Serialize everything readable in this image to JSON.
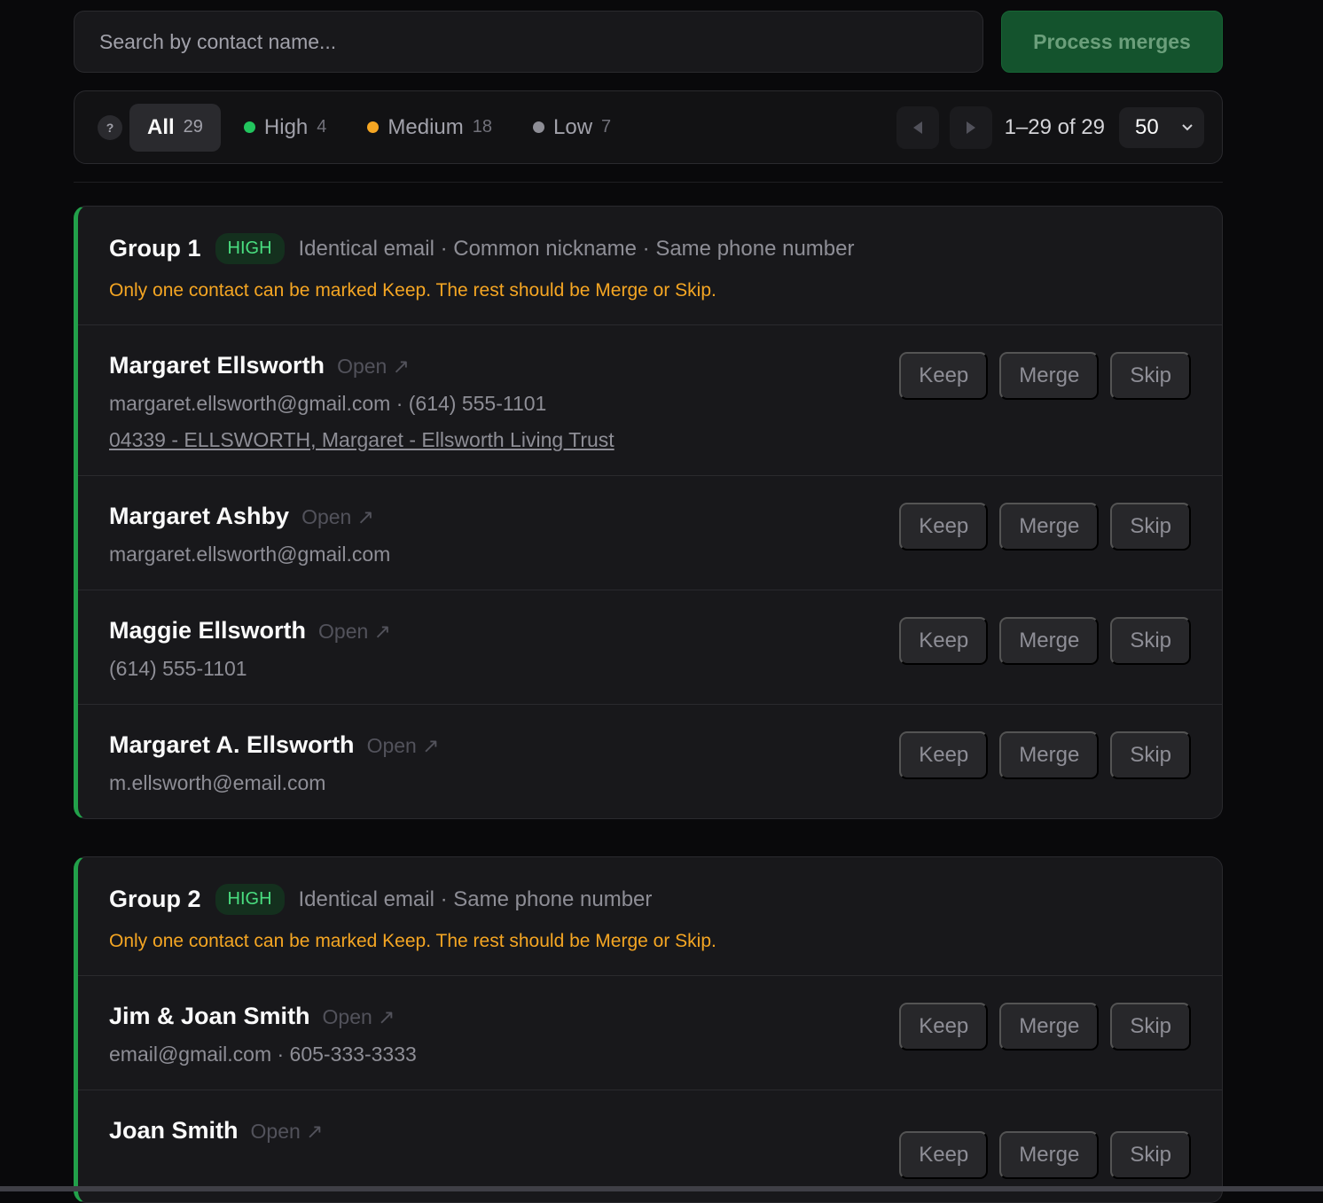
{
  "search": {
    "placeholder": "Search by contact name..."
  },
  "process_button": "Process merges",
  "filters": {
    "help": "?",
    "tabs": [
      {
        "label": "All",
        "count": "29",
        "dot_color": ""
      },
      {
        "label": "High",
        "count": "4",
        "dot_color": "#22c55e"
      },
      {
        "label": "Medium",
        "count": "18",
        "dot_color": "#f5a623"
      },
      {
        "label": "Low",
        "count": "7",
        "dot_color": "#8e8e96"
      }
    ],
    "range": "1–29 of 29",
    "per_page": "50"
  },
  "actions": {
    "keep": "Keep",
    "merge": "Merge",
    "skip": "Skip"
  },
  "open_label": "Open",
  "groups": [
    {
      "title": "Group 1",
      "badge": "HIGH",
      "reasons": "Identical email · Common nickname · Same phone number",
      "warning": "Only one contact can be marked Keep. The rest should be Merge or Skip.",
      "contacts": [
        {
          "name": "Margaret Ellsworth",
          "detail": "margaret.ellsworth@gmail.com · (614) 555-1101",
          "link": "04339 - ELLSWORTH, Margaret - Ellsworth Living Trust"
        },
        {
          "name": "Margaret Ashby",
          "detail": "margaret.ellsworth@gmail.com"
        },
        {
          "name": "Maggie Ellsworth",
          "detail": "(614) 555-1101"
        },
        {
          "name": "Margaret A. Ellsworth",
          "detail": "m.ellsworth@email.com"
        }
      ]
    },
    {
      "title": "Group 2",
      "badge": "HIGH",
      "reasons": "Identical email · Same phone number",
      "warning": "Only one contact can be marked Keep. The rest should be Merge or Skip.",
      "contacts": [
        {
          "name": "Jim & Joan Smith",
          "detail": "email@gmail.com · 605-333-3333"
        },
        {
          "name": "Joan Smith"
        }
      ]
    }
  ],
  "colors": {
    "accent_green": "#22a04a",
    "warning": "#f5a623",
    "badge_text": "#4ade80"
  }
}
